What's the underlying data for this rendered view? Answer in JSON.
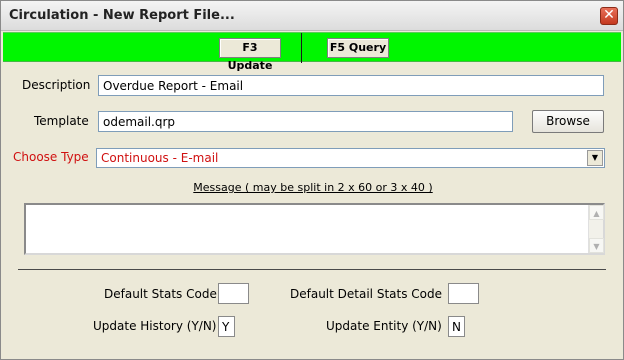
{
  "window": {
    "title": "Circulation - New Report File..."
  },
  "toolbar": {
    "update_label": "F3 Update",
    "query_label": "F5 Query"
  },
  "form": {
    "description_label": "Description",
    "description_value": "Overdue Report - Email",
    "template_label": "Template",
    "template_value": "odemail.qrp",
    "browse_label": "Browse",
    "type_label": "Choose Type",
    "type_value": "Continuous - E-mail",
    "message_label": "Message ( may be split in 2 x 60 or 3 x 40 )",
    "message_value": "",
    "default_stats_label": "Default Stats Code",
    "default_stats_value": "",
    "default_detail_stats_label": "Default Detail Stats Code",
    "default_detail_stats_value": "",
    "update_history_label": "Update History (Y/N)",
    "update_history_value": "Y",
    "update_entity_label": "Update Entity (Y/N)",
    "update_entity_value": "N"
  },
  "colors": {
    "toolbar_bg": "#00f600",
    "required_label": "#d01010",
    "window_bg": "#ece9d8"
  },
  "icons": {
    "close": "close-icon",
    "dropdown": "chevron-down-icon",
    "scroll_up": "scroll-up-icon",
    "scroll_down": "scroll-down-icon"
  }
}
